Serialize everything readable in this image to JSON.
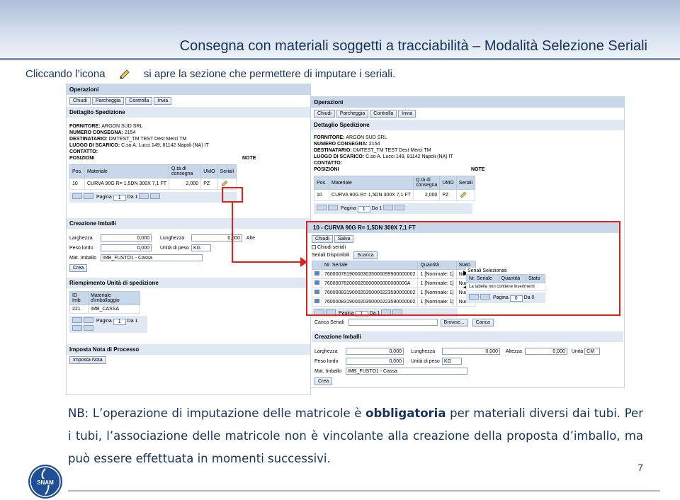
{
  "slide": {
    "title": "Consegna con materiali soggetti a tracciabilità – Modalità Selezione Seriali",
    "intro_before": "Cliccando l’icona",
    "intro_after": "si apre la sezione che permettere di imputare i seriali.",
    "note_prefix": "NB: L’operazione di imputazione delle matricole è ",
    "note_bold": "obbligatoria",
    "note_suffix": " per materiali diversi dai tubi. Per i tubi, l’associazione delle matricole non è vincolante alla creazione della proposta d’imballo, ma può essere effettuata in momenti successivi.",
    "page_number": "7",
    "logo_text": "SNAM",
    "accent_color": "#16325c",
    "highlight_color": "#e0201a"
  },
  "screen_left": {
    "ops_header": "Operazioni",
    "buttons": [
      "Chiudi",
      "Parcheggia",
      "Controlla",
      "Invia"
    ],
    "section_detail": "Dettaglio Spedizione",
    "fornitore_label": "FORNITORE:",
    "fornitore": "ARGON SUD SRL",
    "numero_label": "NUMERO CONSEGNA:",
    "numero": "2154",
    "destinatario_label": "DESTINATARIO:",
    "destinatario": "DMTEST_TM TEST Dest Merci TM",
    "luogo_label": "LUOGO DI SCARICO:",
    "luogo": "C.so A. Lucci 149, 81142 Napoli (NA) IT",
    "contatto_label": "CONTATTO:",
    "posizioni_label": "POSIZIONI",
    "note_label": "NOTE",
    "table_headers": [
      "Pos.",
      "Materiale",
      "Q.tà di consegna",
      "UMO",
      "Seriali"
    ],
    "table_row": [
      "10",
      "CURVA 90G R= 1,5DN 300X 7,1 FT",
      "2,000",
      "PZ",
      ""
    ],
    "pager_label": "Pagina",
    "pager_value": "1",
    "pager_total": "Da 1",
    "section_imballi": "Creazione Imballi",
    "larghezza_label": "Larghezza",
    "larghezza": "0,000",
    "lunghezza_label": "Lunghezza",
    "lunghezza": "0,000",
    "altezza_label": "Alte",
    "peso_label": "Peso lordo",
    "peso": "0,000",
    "unita_label": "Unità di peso",
    "unita": "KG",
    "mat_label": "Mat. Imballo",
    "mat": "IMB_FUSTO1 - Cassa",
    "crea_button": "Crea",
    "section_riempimento": "Riempimento Unità di spedizione",
    "riemp_headers": [
      "ID Imb",
      "Materiale d'imballaggio"
    ],
    "riemp_row": [
      "221",
      "IMB_CASSA"
    ],
    "section_nota": "Imposta Nota di Processo",
    "nota_button": "Imposta Nota"
  },
  "screen_right": {
    "ops_header": "Operazioni",
    "buttons": [
      "Chiudi",
      "Parcheggia",
      "Controlla",
      "Invia"
    ],
    "section_detail": "Dettaglio Spedizione",
    "fornitore_label": "FORNITORE:",
    "fornitore": "ARGON SUD SRL",
    "numero_label": "NUMERO CONSEGNA:",
    "numero": "2154",
    "destinatario_label": "DESTINATARIO:",
    "destinatario": "DMTEST_TM TEST Dest Merci TM",
    "luogo_label": "LUOGO DI SCARICO:",
    "luogo": "C.so A. Lucci 149, 81142 Napoli (NA) IT",
    "contatto_label": "CONTATTO:",
    "posizioni_label": "POSIZIONI",
    "note_label": "NOTE",
    "table_headers": [
      "Pos.",
      "Materiale",
      "Q.tà di consegna",
      "UMO",
      "Seriali"
    ],
    "table_row": [
      "10",
      "CURVA 90G R= 1,5DN 300X 7,1 FT",
      "2,000",
      "PZ",
      ""
    ],
    "pager_label": "Pagina",
    "pager_value": "1",
    "pager_total": "Da 1"
  },
  "serial_panel": {
    "title": "10 - CURVA 90G R= 1,5DN 300X 7,1 FT",
    "buttons": [
      "Chiudi",
      "Salva"
    ],
    "chiudi_seriali": "Chiudi seriali",
    "tab_disponibili": "Seriali Disponibili",
    "tab_scarica": "Scarica",
    "disp_headers": [
      "",
      "Nr. Seriale",
      "Quantità",
      "Stato"
    ],
    "disp_rows": [
      [
        "",
        "760000781900003035000099900000002",
        "1 [Nominale: 1]",
        "Nuovo"
      ],
      [
        "",
        "760000782000020000000000000000A",
        "1 [Nominale: 1]",
        "Nuovo"
      ],
      [
        "",
        "760000831900020350000223590000002",
        "1 [Nominale: 1]",
        "Nuovo"
      ],
      [
        "",
        "760000831900020350000223590000002",
        "1 [Nominale: 1]",
        "Nuovo"
      ]
    ],
    "sel_title": "Seriali Selezionati",
    "sel_headers": [
      "",
      "Nr. Seriale",
      "Quantità",
      "Stato"
    ],
    "sel_empty": "La tabella non contiene inserimenti",
    "pager_label": "Pagina",
    "pager_value": "1",
    "pager_total": "Da 1",
    "sel_pager_value": "0",
    "sel_pager_total": "Da 0",
    "carica_label": "Carica Seriali",
    "browse_button": "Browse...",
    "carica_button": "Carica"
  },
  "imballi_right": {
    "section": "Creazione Imballi",
    "larghezza_label": "Larghezza",
    "larghezza": "0,000",
    "lunghezza_label": "Lunghezza",
    "lunghezza": "0,000",
    "altezza_label": "Altezza",
    "altezza": "0,000",
    "unita_label": "Unità",
    "unita": "CM",
    "peso_label": "Peso lordo",
    "peso": "0,000",
    "unita_peso_label": "Unità di peso",
    "unita_peso": "KG",
    "mat_label": "Mat. Imballo",
    "mat": "IMB_FUSTO1 - Cassa",
    "crea_button": "Crea"
  }
}
